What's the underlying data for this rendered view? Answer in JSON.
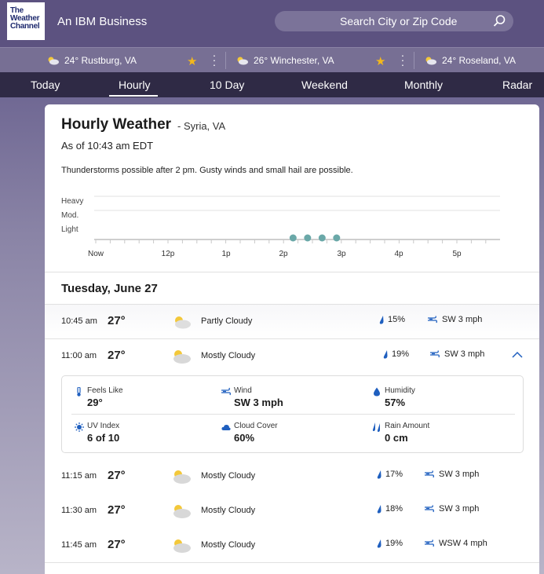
{
  "header": {
    "logo_lines": [
      "The",
      "Weather",
      "Channel"
    ],
    "tagline": "An IBM Business",
    "search_placeholder": "Search City or Zip Code"
  },
  "favorites": [
    {
      "label": "24° Rustburg, VA"
    },
    {
      "label": "26° Winchester, VA"
    },
    {
      "label": "24° Roseland, VA"
    }
  ],
  "nav": {
    "tabs": [
      "Today",
      "Hourly",
      "10 Day",
      "Weekend",
      "Monthly",
      "Radar"
    ],
    "active": "Hourly"
  },
  "page": {
    "title": "Hourly Weather",
    "location": "- Syria, VA",
    "as_of": "As of 10:43 am EDT",
    "alert": "Thunderstorms possible after 2 pm. Gusty winds and small hail are possible."
  },
  "chart_data": {
    "type": "scatter",
    "y_categories": [
      "Heavy",
      "Mod.",
      "Light"
    ],
    "x_ticks": [
      "Now",
      "12p",
      "1p",
      "2p",
      "3p",
      "4p",
      "5p"
    ],
    "precip_points": [
      {
        "time": "2:10p",
        "intensity": "Light"
      },
      {
        "time": "2:25p",
        "intensity": "Light"
      },
      {
        "time": "2:40p",
        "intensity": "Light"
      },
      {
        "time": "2:55p",
        "intensity": "Light"
      }
    ]
  },
  "day": "Tuesday, June 27",
  "rows": [
    {
      "time": "10:45 am",
      "temp": "27°",
      "cond": "Partly Cloudy",
      "rain": "15%",
      "wind": "SW 3 mph"
    },
    {
      "time": "11:00 am",
      "temp": "27°",
      "cond": "Mostly Cloudy",
      "rain": "19%",
      "wind": "SW 3 mph"
    },
    {
      "time": "11:15 am",
      "temp": "27°",
      "cond": "Mostly Cloudy",
      "rain": "17%",
      "wind": "SW 3 mph"
    },
    {
      "time": "11:30 am",
      "temp": "27°",
      "cond": "Mostly Cloudy",
      "rain": "18%",
      "wind": "SW 3 mph"
    },
    {
      "time": "11:45 am",
      "temp": "27°",
      "cond": "Mostly Cloudy",
      "rain": "19%",
      "wind": "WSW 4 mph"
    }
  ],
  "details": {
    "feels_like": {
      "label": "Feels Like",
      "value": "29°"
    },
    "wind": {
      "label": "Wind",
      "value": "SW 3 mph"
    },
    "humidity": {
      "label": "Humidity",
      "value": "57%"
    },
    "uv": {
      "label": "UV Index",
      "value": "6 of 10"
    },
    "cloud": {
      "label": "Cloud Cover",
      "value": "60%"
    },
    "rain_amount": {
      "label": "Rain Amount",
      "value": "0 cm"
    }
  },
  "colors": {
    "brand": "#5c5280",
    "nav": "#2f2a45",
    "star": "#f3b81c",
    "rain": "#1f5fbf",
    "precip_dot": "#6aa8a8"
  }
}
